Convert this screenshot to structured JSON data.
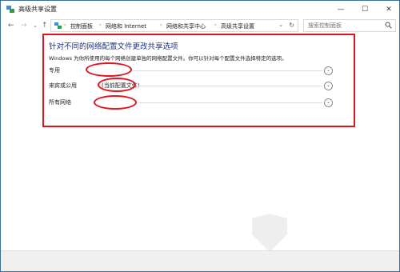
{
  "window": {
    "title": "高级共享设置",
    "title_icon": "network-sharing-icon",
    "controls": {
      "minimize": "—",
      "maximize": "☐",
      "close": "✕"
    }
  },
  "addressbar": {
    "back": "←",
    "forward": "→",
    "recent": "⌄",
    "up": "↑",
    "breadcrumb": [
      "控制面板",
      "网络和 Internet",
      "网络和共享中心",
      "高级共享设置"
    ],
    "separator": "›",
    "dropdown": "⌄",
    "refresh": "↻"
  },
  "search": {
    "placeholder": "搜索控制面板",
    "icon": "search-icon"
  },
  "main": {
    "heading": "针对不同的网络配置文件更改共享选项",
    "description": "Windows 为你所使用的每个网络创建单独的网络配置文件。你可以针对每个配置文件选择特定的选项。",
    "profiles": [
      {
        "label": "专用",
        "current": "",
        "expander": "chevron-down-icon"
      },
      {
        "label": "来宾或公用",
        "current": "(当前配置文件)",
        "expander": "chevron-down-icon"
      },
      {
        "label": "所有网络",
        "current": "",
        "expander": "chevron-down-icon"
      }
    ]
  },
  "colors": {
    "heading": "#1e3287",
    "highlight": "#e0141e",
    "chrome": "#f0f0f0"
  }
}
